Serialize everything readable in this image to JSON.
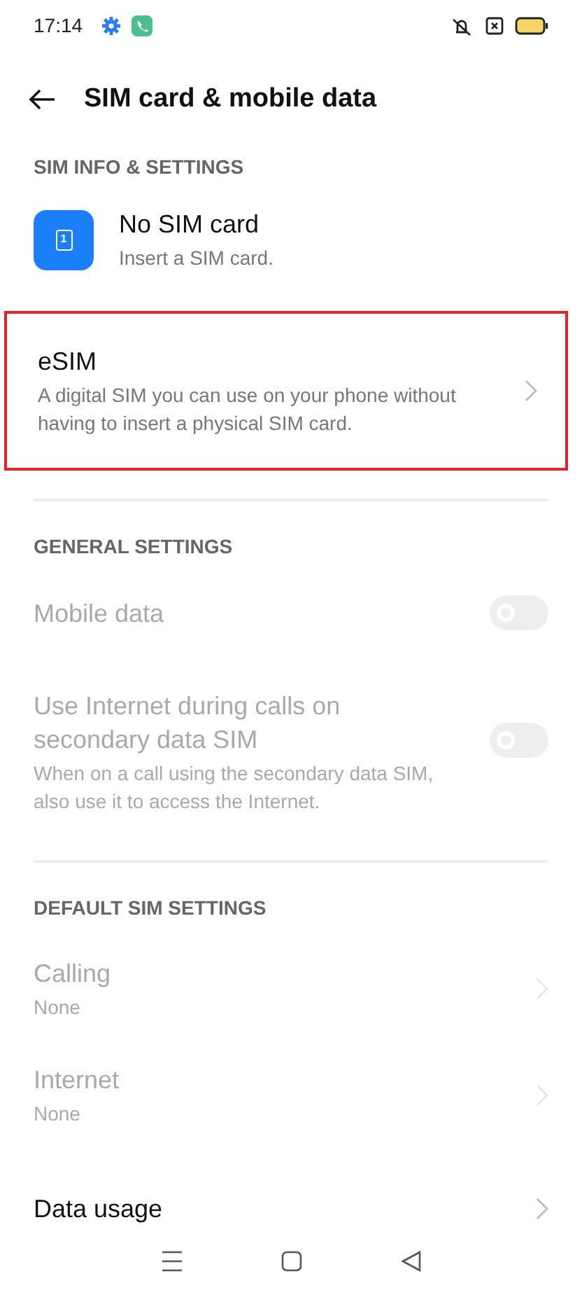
{
  "status_bar": {
    "time": "17:14"
  },
  "header": {
    "title": "SIM card & mobile data"
  },
  "sections": [
    {
      "heading": "SIM INFO & SETTINGS",
      "divider": false,
      "items": [
        {
          "kind": "sim",
          "title": "No SIM card",
          "subtitle": "Insert a SIM card.",
          "badge": "1",
          "disabled": false,
          "highlighted": false
        },
        {
          "kind": "nav",
          "title": "eSIM",
          "subtitle": "A digital SIM you can use on your phone without having to insert a physical SIM card.",
          "disabled": false,
          "highlighted": true
        }
      ]
    },
    {
      "heading": "GENERAL SETTINGS",
      "divider": true,
      "items": [
        {
          "kind": "toggle",
          "title": "Mobile data",
          "on": false,
          "disabled": true
        },
        {
          "kind": "toggle",
          "title": "Use Internet during calls on secondary data SIM",
          "subtitle": "When on a call using the secondary data SIM, also use it to access the Internet.",
          "on": false,
          "disabled": true
        }
      ]
    },
    {
      "heading": "DEFAULT SIM SETTINGS",
      "divider": true,
      "items": [
        {
          "kind": "nav",
          "title": "Calling",
          "subtitle": "None",
          "disabled": true,
          "highlighted": false
        },
        {
          "kind": "nav",
          "title": "Internet",
          "subtitle": "None",
          "disabled": true,
          "highlighted": false
        }
      ]
    },
    {
      "divider": false,
      "items": [
        {
          "kind": "nav",
          "title": "Data usage",
          "disabled": false,
          "highlighted": false
        }
      ]
    }
  ]
}
